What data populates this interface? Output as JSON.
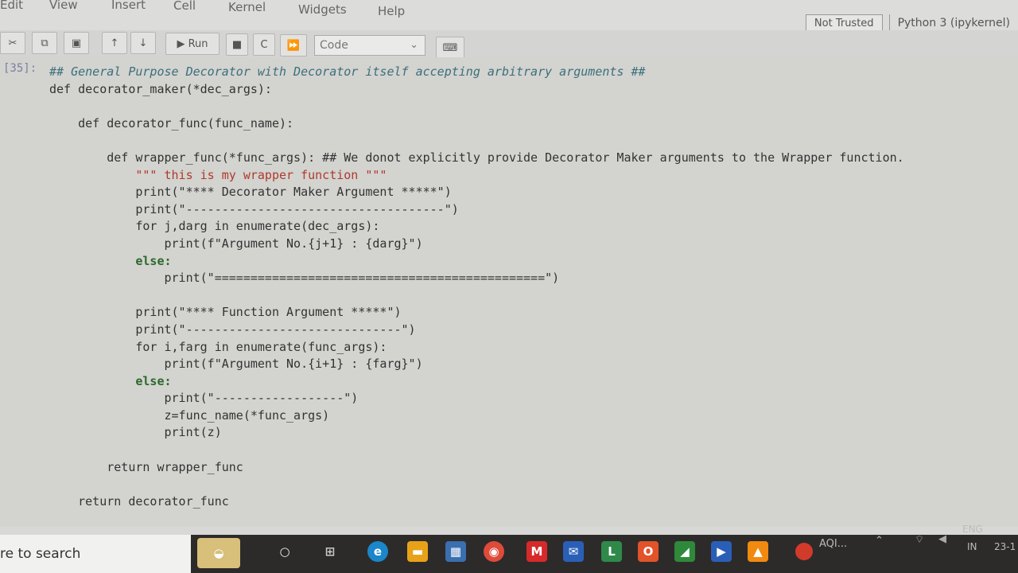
{
  "menu": {
    "items": [
      "Edit",
      "View",
      "Insert",
      "Cell",
      "Kernel",
      "Widgets",
      "Help"
    ]
  },
  "status": {
    "trust": "Not Trusted",
    "kernel": "Python 3 (ipykernel)"
  },
  "toolbar": {
    "run_label": "Run",
    "cell_type": "Code"
  },
  "cell": {
    "prompt": "[35]:"
  },
  "code": {
    "lines": [
      "## General Purpose Decorator with Decorator itself accepting arbitrary arguments ##",
      "def decorator_maker(*dec_args):",
      "",
      "    def decorator_func(func_name):",
      "",
      "        def wrapper_func(*func_args): ## We donot explicitly provide Decorator Maker arguments to the Wrapper function.",
      "            \"\"\" this is my wrapper function \"\"\"",
      "            print(\"**** Decorator Maker Argument *****\")",
      "            print(\"------------------------------------\")",
      "            for j,darg in enumerate(dec_args):",
      "                print(f\"Argument No.{j+1} : {darg}\")",
      "            else:",
      "                print(\"==============================================\")",
      "",
      "            print(\"**** Function Argument *****\")",
      "            print(\"------------------------------\")",
      "            for i,farg in enumerate(func_args):",
      "                print(f\"Argument No.{i+1} : {farg}\")",
      "            else:",
      "                print(\"------------------\")",
      "                z=func_name(*func_args)",
      "                print(z)",
      "",
      "        return wrapper_func",
      "",
      "    return decorator_func"
    ]
  },
  "taskbar": {
    "search_text": "re to search",
    "aqi": "AQI...",
    "lang": "ENG",
    "region": "IN",
    "date_partial": "23-1"
  },
  "icons": [
    "cut-icon",
    "copy-icon",
    "paste-icon",
    "move-up-icon",
    "move-down-icon",
    "run-icon",
    "stop-icon",
    "restart-icon",
    "fast-forward-icon",
    "keyboard-icon",
    "cortana-icon",
    "task-view-icon",
    "edge-icon",
    "store-icon",
    "chrome-icon",
    "mcafee-icon",
    "mail-icon",
    "lens-icon",
    "office-icon",
    "terminal-icon",
    "media-icon",
    "vlc-icon",
    "wifi-icon",
    "volume-icon"
  ]
}
